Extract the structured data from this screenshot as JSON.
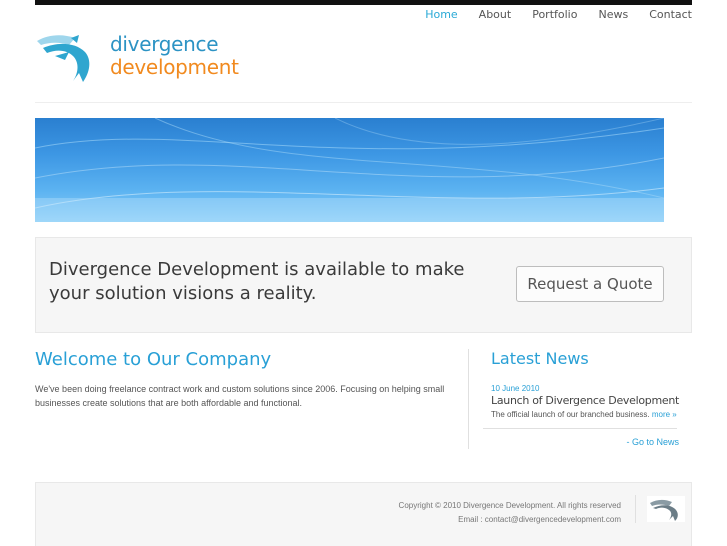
{
  "nav": {
    "items": [
      {
        "label": "Home",
        "active": true
      },
      {
        "label": "About",
        "active": false
      },
      {
        "label": "Portfolio",
        "active": false
      },
      {
        "label": "News",
        "active": false
      },
      {
        "label": "Contact",
        "active": false
      }
    ]
  },
  "logo": {
    "line1": "divergence",
    "line2": "development",
    "icon": "split-arrow-icon"
  },
  "callout": {
    "message": "Divergence Development is available to make your solution visions a reality.",
    "button_label": "Request a Quote"
  },
  "welcome": {
    "heading": "Welcome to Our Company",
    "body": "We've been doing freelance contract work and custom solutions since 2006. Focusing on helping small businesses create solutions that are both affordable and functional."
  },
  "news": {
    "heading": "Latest News",
    "items": [
      {
        "date": "10 June 2010",
        "title": "Launch of Divergence Development",
        "excerpt": "The official launch of our branched business.",
        "more": "more »"
      }
    ],
    "goto_label": "- Go to News"
  },
  "footer": {
    "copyright": "Copyright © 2010 Divergence Development. All rights reserved",
    "email": "Email : contact@divergencedevelopment.com"
  },
  "colors": {
    "accent": "#29a0d6",
    "orange": "#f18a1f",
    "banner": "#3d97e4"
  }
}
